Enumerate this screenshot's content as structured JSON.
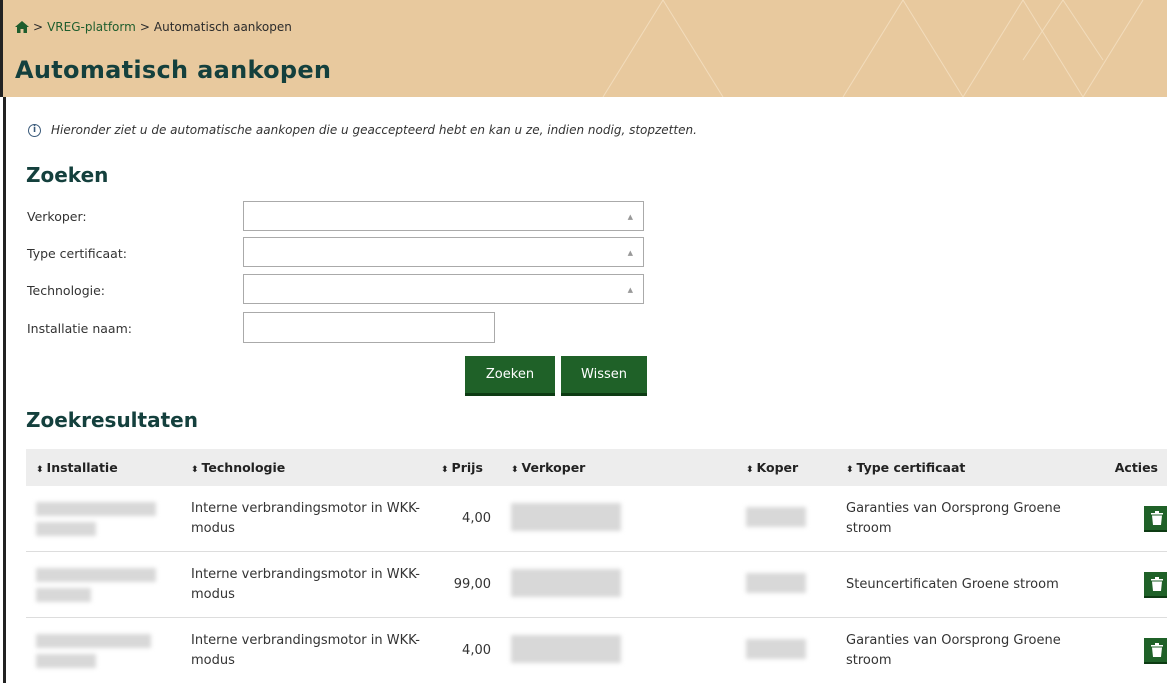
{
  "breadcrumb": {
    "link": "VREG-platform",
    "separator1": ">",
    "separator2": ">",
    "current": "Automatisch aankopen"
  },
  "page_title": "Automatisch aankopen",
  "info_text": "Hieronder ziet u de automatische aankopen die u geaccepteerd hebt en kan u ze, indien nodig, stopzetten.",
  "search": {
    "heading": "Zoeken",
    "verkoper_label": "Verkoper:",
    "type_label": "Type certificaat:",
    "technologie_label": "Technologie:",
    "installatie_label": "Installatie naam:",
    "verkoper_value": "",
    "type_value": "",
    "technologie_value": "",
    "installatie_value": "",
    "search_button": "Zoeken",
    "clear_button": "Wissen"
  },
  "results": {
    "heading": "Zoekresultaten",
    "columns": [
      "Installatie",
      "Technologie",
      "Prijs",
      "Verkoper",
      "Koper",
      "Type certificaat",
      "Acties"
    ],
    "rows": [
      {
        "technologie": "Interne verbrandingsmotor in WKK-modus",
        "prijs": "4,00",
        "type": "Garanties van Oorsprong Groene stroom"
      },
      {
        "technologie": "Interne verbrandingsmotor in WKK-modus",
        "prijs": "99,00",
        "type": "Steuncertificaten Groene stroom"
      },
      {
        "technologie": "Interne verbrandingsmotor in WKK-modus",
        "prijs": "4,00",
        "type": "Garanties van Oorsprong Groene stroom"
      }
    ]
  },
  "colors": {
    "accent": "#1f6128",
    "heading": "#14403d",
    "banner": "#e8c99e"
  },
  "icons": {
    "home": "home-icon",
    "info": "info-icon",
    "sort": "sort-icon",
    "delete": "trash-icon"
  }
}
